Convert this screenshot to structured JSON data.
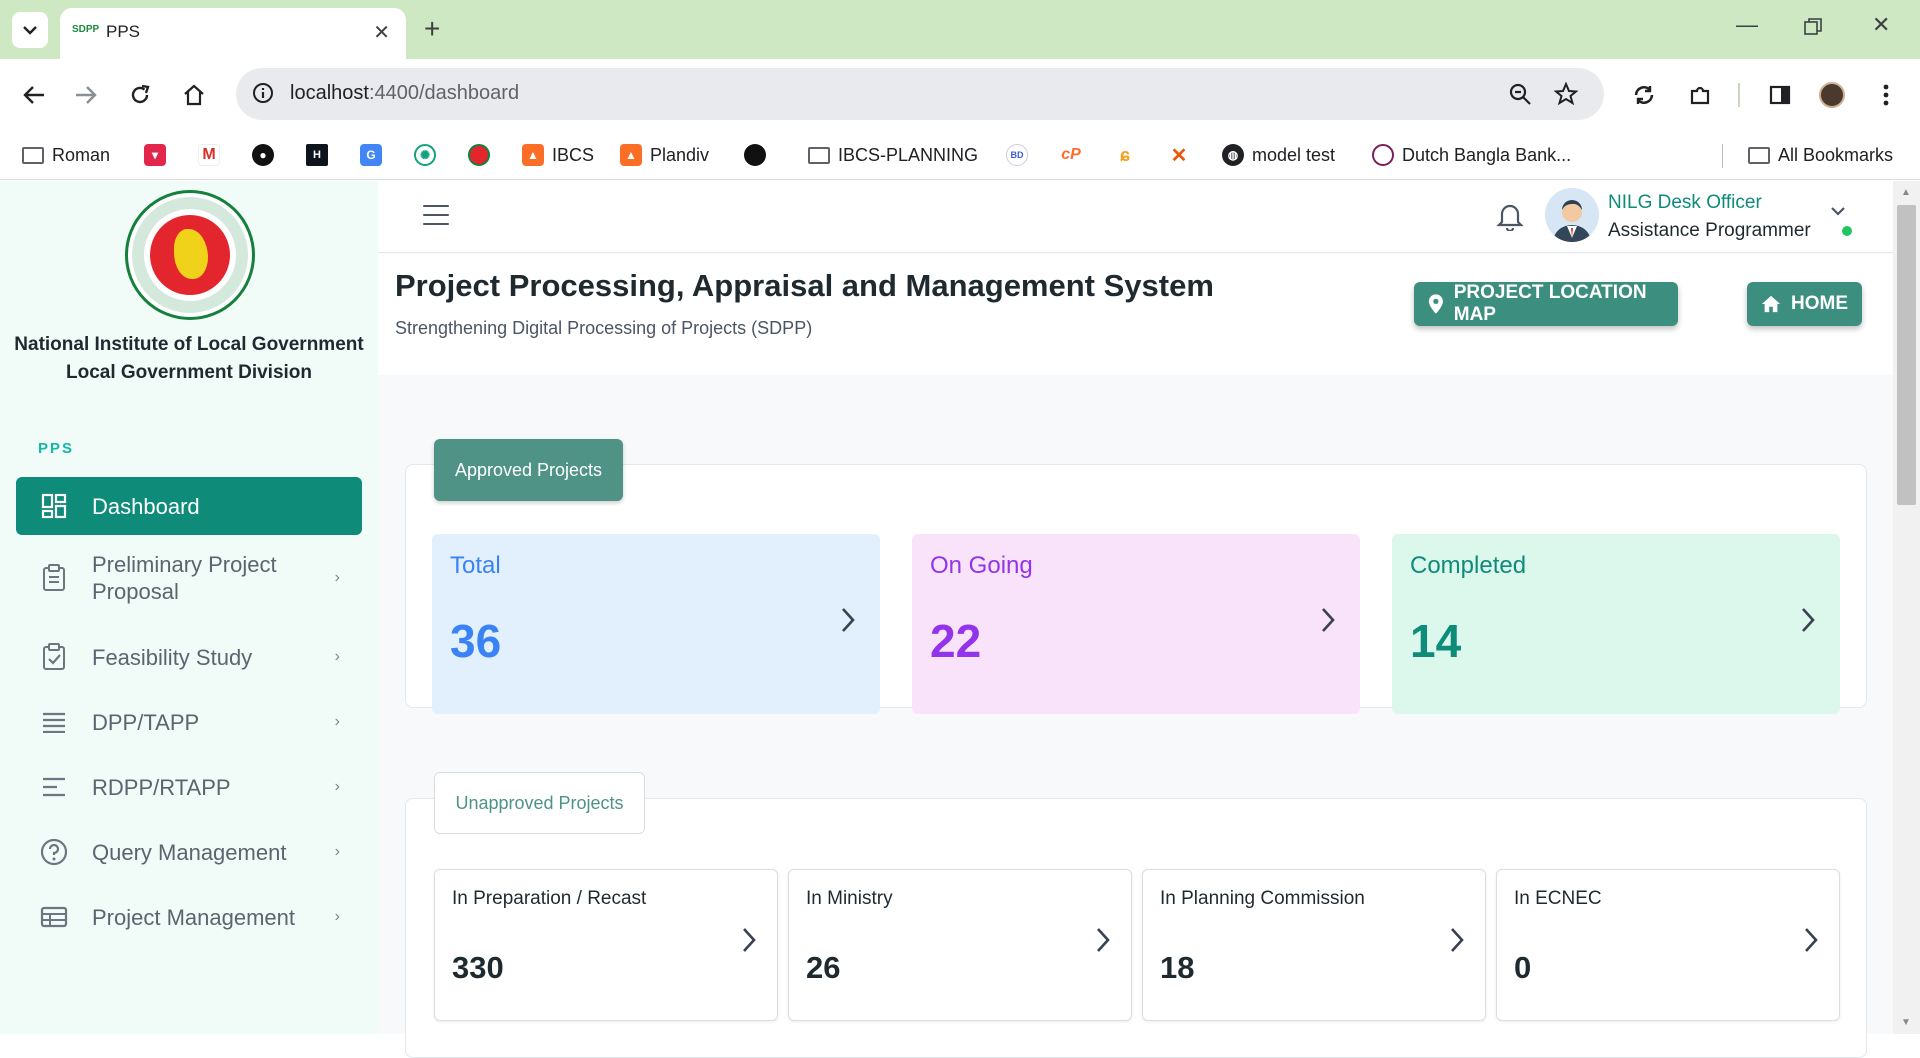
{
  "browser": {
    "tab_title": "PPS",
    "tab_favicon_text": "SDPP",
    "url_host": "localhost",
    "url_rest": ":4400/dashboard",
    "bookmarks": [
      {
        "label": "Roman",
        "icon": "folder-icon"
      },
      {
        "label": "",
        "icon": "pocket-icon"
      },
      {
        "label": "",
        "icon": "gmail-icon"
      },
      {
        "label": "",
        "icon": "github-icon"
      },
      {
        "label": "",
        "icon": "hackerrank-icon"
      },
      {
        "label": "",
        "icon": "google-translate-icon"
      },
      {
        "label": "",
        "icon": "chatgpt-icon"
      },
      {
        "label": "",
        "icon": "bd-gov-icon"
      },
      {
        "label": "IBCS",
        "icon": "gitlab-icon"
      },
      {
        "label": "Plandiv",
        "icon": "gitlab-icon"
      },
      {
        "label": "",
        "icon": "dark-circle-icon"
      },
      {
        "label": "IBCS-PLANNING",
        "icon": "folder-icon"
      },
      {
        "label": "",
        "icon": "bd-icon"
      },
      {
        "label": "",
        "icon": "cpanel-icon"
      },
      {
        "label": "",
        "icon": "leetcode-icon"
      },
      {
        "label": "",
        "icon": "x-icon"
      },
      {
        "label": "model test",
        "icon": "globe-icon"
      },
      {
        "label": "Dutch Bangla Bank...",
        "icon": "dbbl-icon"
      }
    ],
    "all_bookmarks": "All Bookmarks"
  },
  "sidebar": {
    "org_line1": "National Institute of Local Government",
    "org_line2": "Local Government Division",
    "section": "PPS",
    "items": [
      {
        "label": "Dashboard",
        "icon": "dashboard-icon",
        "active": true
      },
      {
        "label": "Preliminary Project Proposal",
        "icon": "clipboard-icon"
      },
      {
        "label": "Feasibility Study",
        "icon": "clipboard-check-icon"
      },
      {
        "label": "DPP/TAPP",
        "icon": "list-icon"
      },
      {
        "label": "RDPP/RTAPP",
        "icon": "align-left-icon"
      },
      {
        "label": "Query Management",
        "icon": "help-circle-icon"
      },
      {
        "label": "Project Management",
        "icon": "table-icon"
      }
    ]
  },
  "topbar": {
    "user_name": "NILG Desk Officer",
    "user_role": "Assistance Programmer"
  },
  "header": {
    "title": "Project Processing, Appraisal and Management System",
    "subtitle": "Strengthening Digital Processing of Projects (SDPP)",
    "map_button": "PROJECT LOCATION MAP",
    "home_button": "HOME"
  },
  "approved": {
    "tab_label": "Approved Projects",
    "cards": [
      {
        "label": "Total",
        "value": "36",
        "bg": "#e2f0fd",
        "color": "#3b82f6"
      },
      {
        "label": "On Going",
        "value": "22",
        "bg": "#f9e3fb",
        "color": "#9333ea"
      },
      {
        "label": "Completed",
        "value": "14",
        "bg": "#dcf7ec",
        "color": "#0f8b7a"
      }
    ]
  },
  "unapproved": {
    "tab_label": "Unapproved Projects",
    "cards": [
      {
        "label": "In Preparation / Recast",
        "value": "330"
      },
      {
        "label": "In Ministry",
        "value": "26"
      },
      {
        "label": "In Planning Commission",
        "value": "18"
      },
      {
        "label": "In ECNEC",
        "value": "0"
      }
    ]
  },
  "colors": {
    "accent": "#0f8b7a",
    "button": "#3c8f7f",
    "chrome": "#cfe8c4"
  }
}
